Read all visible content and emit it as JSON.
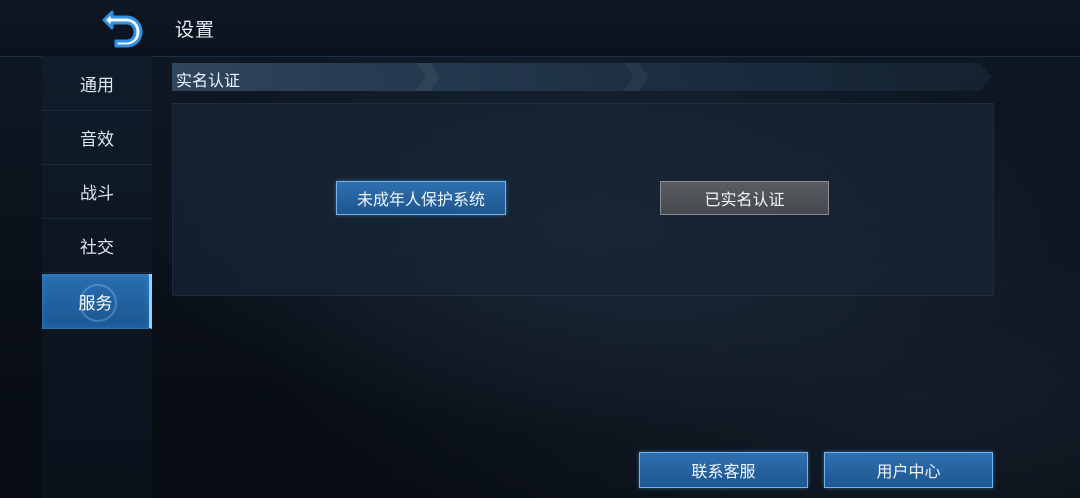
{
  "header": {
    "title": "设置",
    "back_icon": "back-arrow-icon"
  },
  "sidebar": {
    "items": [
      {
        "label": "通用"
      },
      {
        "label": "音效"
      },
      {
        "label": "战斗"
      },
      {
        "label": "社交"
      },
      {
        "label": "服务",
        "active": true
      }
    ]
  },
  "section": {
    "title": "实名认证"
  },
  "panel": {
    "minor_protection_label": "未成年人保护系统",
    "verified_label": "已实名认证"
  },
  "footer": {
    "contact_label": "联系客服",
    "user_center_label": "用户中心"
  },
  "colors": {
    "accent_blue": "#2a6fb0",
    "accent_border": "#6fb6f0",
    "gray_button": "#525559"
  }
}
